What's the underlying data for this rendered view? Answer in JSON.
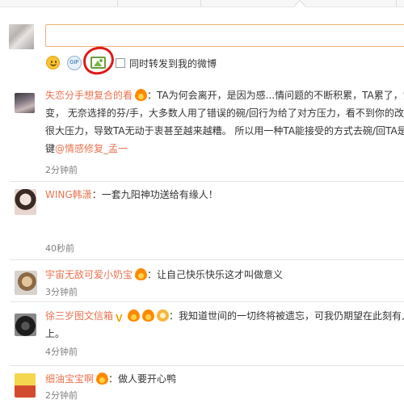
{
  "composer": {
    "input_value": "",
    "repost_label": "同时转发到我的微博",
    "gif_label": "GIF"
  },
  "comments": [
    {
      "name": "失恋分手想复合的看",
      "separator": "：",
      "text": "TA为何会离开，是因为感...情问题的不断积累，TA累了，觉",
      "continuation": [
        "变， 无奈选择的芬/手，大多数人用了错误的碗/回行为给了对方压力，看不到你的改变",
        "很大压力，导致TA无动于衷甚至越来越糟。 所以用一种TA能接受的方式去碗/回TA是关",
        "键"
      ],
      "mention": "@情感修复_孟一",
      "time": "2分钟前"
    },
    {
      "name": "WING韩潇",
      "separator": "：",
      "text": "一套九阳神功送给有缘人！",
      "time": "40秒前"
    },
    {
      "name": "宇宙无敌可爱小奶宝",
      "separator": "：",
      "text": "让自己快乐快乐这才叫做意义",
      "time": "3分钟前"
    },
    {
      "name": "徐三岁图文信箱",
      "separator": "：",
      "text": "我知道世间的一切终将被遗忘，可我仍期望在此刻有人和",
      "continuation": [
        "上。"
      ],
      "time": "4分钟前"
    },
    {
      "name": "细油宝宝啊",
      "separator": "：",
      "text": "做人要开心鸭",
      "time": "2分钟前"
    }
  ]
}
